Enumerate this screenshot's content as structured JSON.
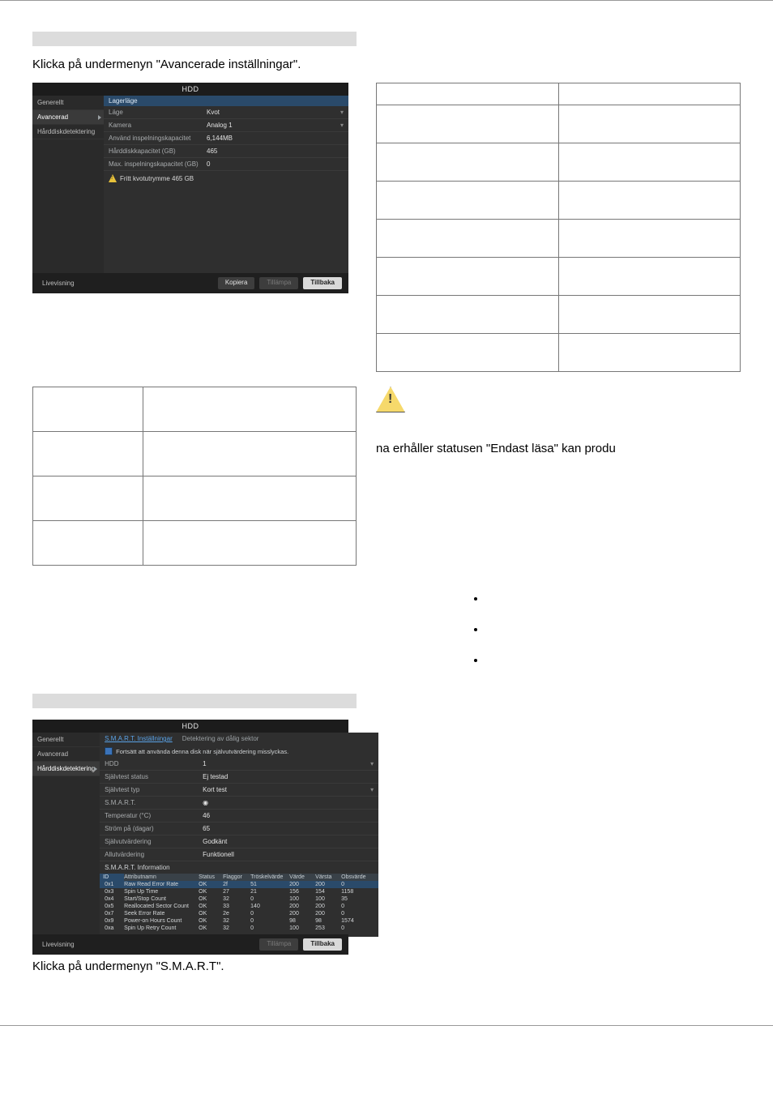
{
  "intro1": "Klicka på undermenyn \"Avancerade inställningar\".",
  "shot1": {
    "title": "HDD",
    "side": {
      "generellt": "Generellt",
      "avancerad": "Avancerad",
      "detektering": "Hårddiskdetektering"
    },
    "panelHead": "Lagerläge",
    "kv": {
      "lage": {
        "k": "Läge",
        "v": "Kvot"
      },
      "kamera": {
        "k": "Kamera",
        "v": "Analog 1"
      },
      "anvand": {
        "k": "Använd inspelningskapacitet",
        "v": "6,144MB"
      },
      "hdkap": {
        "k": "Hårddiskkapacitet (GB)",
        "v": "465"
      },
      "maxkap": {
        "k": "Max. inspelningskapacitet (GB)",
        "v": "0"
      }
    },
    "warn": "Fritt kvotutrymme 465 GB",
    "foot": {
      "live": "Livevisning",
      "kopiera": "Kopiera",
      "tillampa": "Tillämpa",
      "tillbaka": "Tillbaka"
    }
  },
  "caution": "na erhåller statusen \"Endast läsa\" kan produ",
  "intro2": "Klicka på undermenyn \"S.M.A.R.T\".",
  "shot2": {
    "title": "HDD",
    "side": {
      "generellt": "Generellt",
      "avancerad": "Avancerad",
      "detektering": "Hårddiskdetektering"
    },
    "tabs": {
      "smart": "S.M.A.R.T. Inställningar",
      "bad": "Detektering av dålig sektor"
    },
    "chk": "Fortsätt att använda denna disk när självutvärdering misslyckas.",
    "kv": {
      "hdd": {
        "k": "HDD",
        "v": "1"
      },
      "sstat": {
        "k": "Självtest status",
        "v": "Ej testad"
      },
      "styp": {
        "k": "Självtest typ",
        "v": "Kort test"
      },
      "smart": {
        "k": "S.M.A.R.T.",
        "v": "◉"
      },
      "temp": {
        "k": "Temperatur (°C)",
        "v": "46"
      },
      "days": {
        "k": "Ström på (dagar)",
        "v": "65"
      },
      "self": {
        "k": "Självutvärdering",
        "v": "Godkänt"
      },
      "all": {
        "k": "Allutvärdering",
        "v": "Funktionell"
      }
    },
    "infoTitle": "S.M.A.R.T. Information",
    "head": {
      "id": "ID",
      "attr": "Attributnamn",
      "status": "Status",
      "flaggor": "Flaggor",
      "tr": "Tröskelvärde",
      "varde": "Värde",
      "varsta": "Värsta",
      "dr": "Obsvärde"
    },
    "rows": [
      {
        "id": "0x1",
        "attr": "Raw Read Error Rate",
        "status": "OK",
        "fl": "2f",
        "tr": "51",
        "va": "200",
        "wo": "200",
        "dr": "0"
      },
      {
        "id": "0x3",
        "attr": "Spin Up Time",
        "status": "OK",
        "fl": "27",
        "tr": "21",
        "va": "156",
        "wo": "154",
        "dr": "1158"
      },
      {
        "id": "0x4",
        "attr": "Start/Stop Count",
        "status": "OK",
        "fl": "32",
        "tr": "0",
        "va": "100",
        "wo": "100",
        "dr": "35"
      },
      {
        "id": "0x5",
        "attr": "Reallocated Sector Count",
        "status": "OK",
        "fl": "33",
        "tr": "140",
        "va": "200",
        "wo": "200",
        "dr": "0"
      },
      {
        "id": "0x7",
        "attr": "Seek Error Rate",
        "status": "OK",
        "fl": "2e",
        "tr": "0",
        "va": "200",
        "wo": "200",
        "dr": "0"
      },
      {
        "id": "0x9",
        "attr": "Power-on Hours Count",
        "status": "OK",
        "fl": "32",
        "tr": "0",
        "va": "98",
        "wo": "98",
        "dr": "1574"
      },
      {
        "id": "0xa",
        "attr": "Spin Up Retry Count",
        "status": "OK",
        "fl": "32",
        "tr": "0",
        "va": "100",
        "wo": "253",
        "dr": "0"
      }
    ],
    "foot": {
      "live": "Livevisning",
      "tillampa": "Tillämpa",
      "tillbaka": "Tillbaka"
    }
  }
}
